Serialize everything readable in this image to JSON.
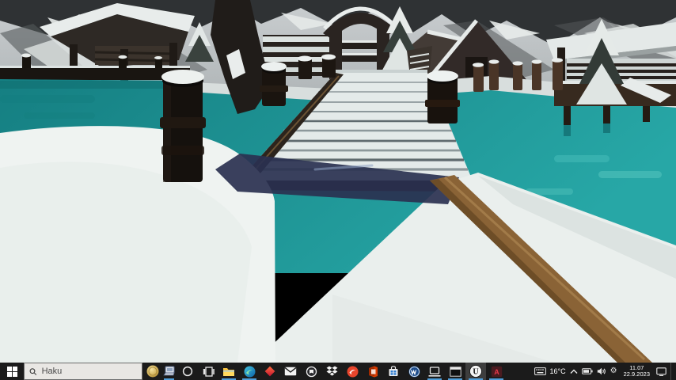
{
  "scene": {
    "name": "snowy-village-pier",
    "description": "Stylized 3D winter village seen in a game viewport: a snow-covered wooden pier with dark bollards extends over teal water; snowy huts, a log cabin, a wooden arch gate, spruces and mountains line the shore; a brown wooden beam crosses the snowy foreground",
    "colors": {
      "water_dark": "#157f82",
      "water": "#27a7a6",
      "water_light": "#3fb7b3",
      "snow": "#eff3f1",
      "snow_shade": "#dce3e1",
      "wood_dark": "#1a140f",
      "wood_brown": "#8a6336",
      "mountain": "#b7bcbe",
      "rock_dark": "#2f3234",
      "shadow_navy": "#2a3150",
      "taskbar_bg": "#1b1b1b",
      "search_bg": "#e9e7e4",
      "accent": "#4f9ed9"
    }
  },
  "taskbar": {
    "search": {
      "placeholder": "Haku",
      "value": ""
    },
    "apps": [
      {
        "name": "coin-app",
        "running": false
      },
      {
        "name": "laptop-app",
        "running": true
      },
      {
        "name": "cortana",
        "running": false
      },
      {
        "name": "task-view",
        "running": false
      },
      {
        "name": "file-explorer",
        "running": true
      },
      {
        "name": "edge-browser",
        "running": true
      },
      {
        "name": "diamond-app",
        "running": false
      },
      {
        "name": "mail",
        "running": false
      },
      {
        "name": "round-app",
        "running": false
      },
      {
        "name": "dropbox",
        "running": false
      },
      {
        "name": "red-circle-app",
        "running": false
      },
      {
        "name": "office",
        "running": false
      },
      {
        "name": "microsoft-store",
        "running": false
      },
      {
        "name": "blue-circle-app",
        "running": false
      },
      {
        "name": "laptop-display-app",
        "running": true
      },
      {
        "name": "console-app",
        "running": true
      },
      {
        "name": "unreal-engine",
        "running": true,
        "focused": true
      },
      {
        "name": "a-app",
        "running": true
      }
    ],
    "glyphs": {
      "unreal": "U",
      "a_app": "A"
    },
    "tray": {
      "temperature": "16°C",
      "time": "11.07",
      "date": "22.9.2023",
      "gear": "⚙"
    }
  }
}
